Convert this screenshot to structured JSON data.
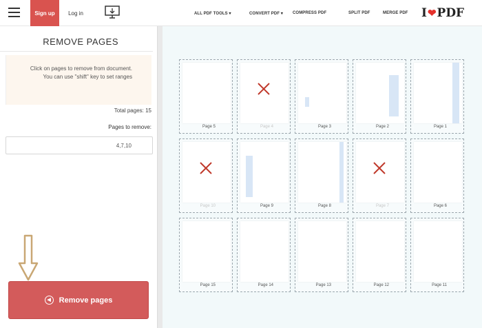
{
  "header": {
    "signup_label": "Sign up",
    "login_label": "Log in",
    "nav": {
      "merge": "MERGE PDF",
      "split": "SPLIT PDF",
      "compress": "COMPRESS PDF",
      "convert": "CONVERT PDF ▾",
      "all_tools": "ALL PDF TOOLS ▾"
    },
    "logo_left": "I",
    "logo_right": "PDF"
  },
  "panel": {
    "title": "REMOVE PAGES",
    "info": "Click on pages to remove from document. You can use \"shift\" key to set ranges",
    "total_pages": "Total pages: 15",
    "pages_label": "Pages to remove:",
    "pages_value": "4,7,10",
    "remove_button": "Remove pages"
  },
  "pages": [
    {
      "label": "Page 1",
      "removed": false
    },
    {
      "label": "Page 2",
      "removed": false
    },
    {
      "label": "Page 3",
      "removed": false
    },
    {
      "label": "Page 4",
      "removed": true
    },
    {
      "label": "Page 5",
      "removed": false
    },
    {
      "label": "Page 6",
      "removed": false
    },
    {
      "label": "Page 7",
      "removed": true
    },
    {
      "label": "Page 8",
      "removed": false
    },
    {
      "label": "Page 9",
      "removed": false
    },
    {
      "label": "Page 10",
      "removed": true
    },
    {
      "label": "Page 11",
      "removed": false
    },
    {
      "label": "Page 12",
      "removed": false
    },
    {
      "label": "Page 13",
      "removed": false
    },
    {
      "label": "Page 14",
      "removed": false
    },
    {
      "label": "Page 15",
      "removed": false
    }
  ],
  "colors": {
    "brand": "#e5322d",
    "remove_button": "#d35b5b",
    "x_mark": "#c0392b"
  }
}
